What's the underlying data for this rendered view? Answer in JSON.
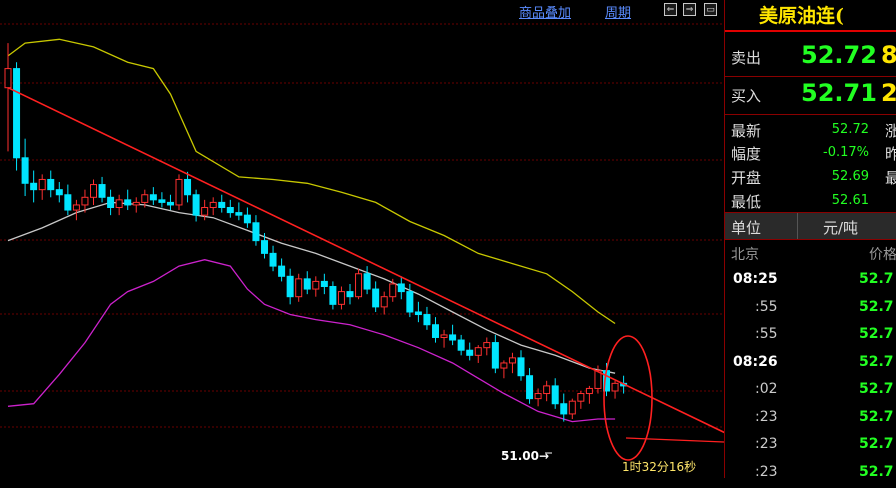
{
  "toolbar": {
    "overlay_label": "商品叠加",
    "period_label": "周期",
    "btn_left": "⇐",
    "btn_right": "⇒",
    "btn_window": "▭"
  },
  "annotations": {
    "low_price_label": "51.00→",
    "elapsed_time": "1时32分16秒"
  },
  "quote": {
    "title": "美原油连(",
    "sell_label": "卖出",
    "sell_price": "52.72",
    "sell_volume": "8",
    "buy_label": "买入",
    "buy_price": "52.71",
    "buy_volume": "2",
    "stats": [
      {
        "label": "最新",
        "value": "52.72",
        "right_label": "涨"
      },
      {
        "label": "幅度",
        "value": "-0.17%",
        "right_label": "昨"
      },
      {
        "label": "开盘",
        "value": "52.69",
        "right_label": "最"
      },
      {
        "label": "最低",
        "value": "52.61",
        "right_label": ""
      }
    ],
    "unit_label": "单位",
    "unit_value": "元/吨",
    "ticks_header": {
      "left": "北京",
      "right": "价格"
    },
    "ticks": [
      {
        "time": "08:25",
        "major": true,
        "price": "52.7"
      },
      {
        "time": ":55",
        "major": false,
        "price": "52.7"
      },
      {
        "time": ":55",
        "major": false,
        "price": "52.7"
      },
      {
        "time": "08:26",
        "major": true,
        "price": "52.7"
      },
      {
        "time": ":02",
        "major": false,
        "price": "52.7"
      },
      {
        "time": ":23",
        "major": false,
        "price": "52.7"
      },
      {
        "time": ":23",
        "major": false,
        "price": "52.7"
      },
      {
        "time": ":23",
        "major": false,
        "price": "52.7"
      }
    ]
  },
  "colors": {
    "up": "#ff3030",
    "down": "#00e5ff",
    "upper_band": "#c8c800",
    "mid_band": "#c8c8c8",
    "lower_band": "#cc22cc",
    "trendline": "#ff2020",
    "grid": "#6a0000",
    "price_green": "#22ff22",
    "price_red": "#ff3333"
  },
  "chart_data": {
    "type": "candlestick",
    "series_note": "",
    "candles": [
      [
        53.6,
        53.95,
        53.1,
        53.75
      ],
      [
        53.75,
        53.8,
        52.95,
        53.05
      ],
      [
        53.05,
        53.2,
        52.75,
        52.85
      ],
      [
        52.85,
        52.95,
        52.7,
        52.8
      ],
      [
        52.8,
        52.92,
        52.72,
        52.88
      ],
      [
        52.88,
        52.95,
        52.74,
        52.8
      ],
      [
        52.8,
        52.86,
        52.7,
        52.76
      ],
      [
        52.76,
        52.84,
        52.6,
        52.64
      ],
      [
        52.64,
        52.72,
        52.56,
        52.68
      ],
      [
        52.68,
        52.8,
        52.62,
        52.74
      ],
      [
        52.74,
        52.88,
        52.68,
        52.84
      ],
      [
        52.84,
        52.9,
        52.7,
        52.74
      ],
      [
        52.74,
        52.8,
        52.6,
        52.66
      ],
      [
        52.66,
        52.76,
        52.6,
        52.72
      ],
      [
        52.72,
        52.8,
        52.64,
        52.68
      ],
      [
        52.68,
        52.74,
        52.62,
        52.7
      ],
      [
        52.7,
        52.8,
        52.66,
        52.76
      ],
      [
        52.76,
        52.82,
        52.68,
        52.72
      ],
      [
        52.72,
        52.78,
        52.66,
        52.7
      ],
      [
        52.7,
        52.76,
        52.64,
        52.68
      ],
      [
        52.68,
        52.92,
        52.64,
        52.88
      ],
      [
        52.88,
        52.94,
        52.7,
        52.76
      ],
      [
        52.76,
        52.8,
        52.55,
        52.6
      ],
      [
        52.6,
        52.72,
        52.56,
        52.66
      ],
      [
        52.66,
        52.74,
        52.6,
        52.7
      ],
      [
        52.7,
        52.76,
        52.62,
        52.66
      ],
      [
        52.66,
        52.72,
        52.58,
        52.62
      ],
      [
        52.62,
        52.7,
        52.56,
        52.6
      ],
      [
        52.6,
        52.66,
        52.5,
        52.54
      ],
      [
        52.54,
        52.6,
        52.36,
        52.4
      ],
      [
        52.4,
        52.46,
        52.26,
        52.3
      ],
      [
        52.3,
        52.36,
        52.16,
        52.2
      ],
      [
        52.2,
        52.26,
        52.08,
        52.12
      ],
      [
        52.12,
        52.18,
        51.9,
        51.96
      ],
      [
        51.96,
        52.14,
        51.92,
        52.1
      ],
      [
        52.1,
        52.16,
        51.98,
        52.02
      ],
      [
        52.02,
        52.12,
        51.96,
        52.08
      ],
      [
        52.08,
        52.14,
        51.98,
        52.04
      ],
      [
        52.04,
        52.08,
        51.86,
        51.9
      ],
      [
        51.9,
        52.04,
        51.86,
        52.0
      ],
      [
        52.0,
        52.06,
        51.9,
        51.96
      ],
      [
        51.96,
        52.18,
        51.94,
        52.14
      ],
      [
        52.14,
        52.2,
        51.98,
        52.02
      ],
      [
        52.02,
        52.08,
        51.84,
        51.88
      ],
      [
        51.88,
        52.0,
        51.82,
        51.96
      ],
      [
        51.96,
        52.1,
        51.92,
        52.06
      ],
      [
        52.06,
        52.12,
        51.94,
        52.0
      ],
      [
        52.0,
        52.06,
        51.8,
        51.84
      ],
      [
        51.84,
        51.92,
        51.76,
        51.82
      ],
      [
        51.82,
        51.88,
        51.7,
        51.74
      ],
      [
        51.74,
        51.8,
        51.6,
        51.64
      ],
      [
        51.64,
        51.7,
        51.56,
        51.66
      ],
      [
        51.66,
        51.74,
        51.58,
        51.62
      ],
      [
        51.62,
        51.66,
        51.5,
        51.54
      ],
      [
        51.54,
        51.6,
        51.46,
        51.5
      ],
      [
        51.5,
        51.58,
        51.44,
        51.56
      ],
      [
        51.56,
        51.64,
        51.5,
        51.6
      ],
      [
        51.6,
        51.66,
        51.36,
        51.4
      ],
      [
        51.4,
        51.46,
        51.32,
        51.44
      ],
      [
        51.44,
        51.52,
        51.36,
        51.48
      ],
      [
        51.48,
        51.54,
        51.3,
        51.34
      ],
      [
        51.34,
        51.4,
        51.12,
        51.16
      ],
      [
        51.16,
        51.24,
        51.1,
        51.2
      ],
      [
        51.2,
        51.3,
        51.14,
        51.26
      ],
      [
        51.26,
        51.32,
        51.08,
        51.12
      ],
      [
        51.12,
        51.2,
        50.98,
        51.04
      ],
      [
        51.04,
        51.16,
        51.0,
        51.14
      ],
      [
        51.14,
        51.22,
        51.08,
        51.2
      ],
      [
        51.2,
        51.26,
        51.12,
        51.24
      ],
      [
        51.24,
        51.42,
        51.2,
        51.38
      ],
      [
        51.38,
        51.44,
        51.18,
        51.22
      ],
      [
        51.22,
        51.3,
        51.16,
        51.28
      ],
      [
        51.28,
        51.34,
        51.2,
        51.26
      ]
    ],
    "upper_band": [
      [
        0,
        53.85
      ],
      [
        2,
        53.95
      ],
      [
        6,
        53.98
      ],
      [
        10,
        53.92
      ],
      [
        14,
        53.8
      ],
      [
        17,
        53.75
      ],
      [
        19,
        53.55
      ],
      [
        22,
        53.1
      ],
      [
        27,
        52.9
      ],
      [
        31,
        52.88
      ],
      [
        35,
        52.85
      ],
      [
        39,
        52.78
      ],
      [
        43,
        52.7
      ],
      [
        47,
        52.55
      ],
      [
        51,
        52.44
      ],
      [
        55,
        52.3
      ],
      [
        59,
        52.22
      ],
      [
        63,
        52.14
      ],
      [
        66,
        52.0
      ],
      [
        69,
        51.84
      ],
      [
        71,
        51.75
      ]
    ],
    "mid_band": [
      [
        0,
        52.4
      ],
      [
        4,
        52.5
      ],
      [
        8,
        52.62
      ],
      [
        12,
        52.7
      ],
      [
        16,
        52.68
      ],
      [
        20,
        52.62
      ],
      [
        24,
        52.58
      ],
      [
        28,
        52.48
      ],
      [
        32,
        52.38
      ],
      [
        36,
        52.3
      ],
      [
        40,
        52.2
      ],
      [
        44,
        52.1
      ],
      [
        48,
        51.98
      ],
      [
        52,
        51.84
      ],
      [
        56,
        51.7
      ],
      [
        60,
        51.58
      ],
      [
        64,
        51.5
      ],
      [
        68,
        51.4
      ],
      [
        71,
        51.36
      ]
    ],
    "lower_band": [
      [
        0,
        51.1
      ],
      [
        3,
        51.12
      ],
      [
        6,
        51.35
      ],
      [
        9,
        51.6
      ],
      [
        12,
        51.9
      ],
      [
        14,
        52.0
      ],
      [
        17,
        52.08
      ],
      [
        20,
        52.2
      ],
      [
        23,
        52.25
      ],
      [
        26,
        52.2
      ],
      [
        28,
        52.02
      ],
      [
        30,
        51.9
      ],
      [
        33,
        51.82
      ],
      [
        36,
        51.78
      ],
      [
        40,
        51.74
      ],
      [
        44,
        51.66
      ],
      [
        48,
        51.56
      ],
      [
        52,
        51.44
      ],
      [
        55,
        51.32
      ],
      [
        58,
        51.2
      ],
      [
        62,
        51.06
      ],
      [
        66,
        50.98
      ],
      [
        69,
        51.0
      ],
      [
        71,
        51.0
      ]
    ],
    "trendline": [
      [
        0,
        53.6
      ],
      [
        96,
        50.5
      ]
    ],
    "low_marker": 51.0,
    "ylim": [
      50.6,
      54.1
    ]
  }
}
